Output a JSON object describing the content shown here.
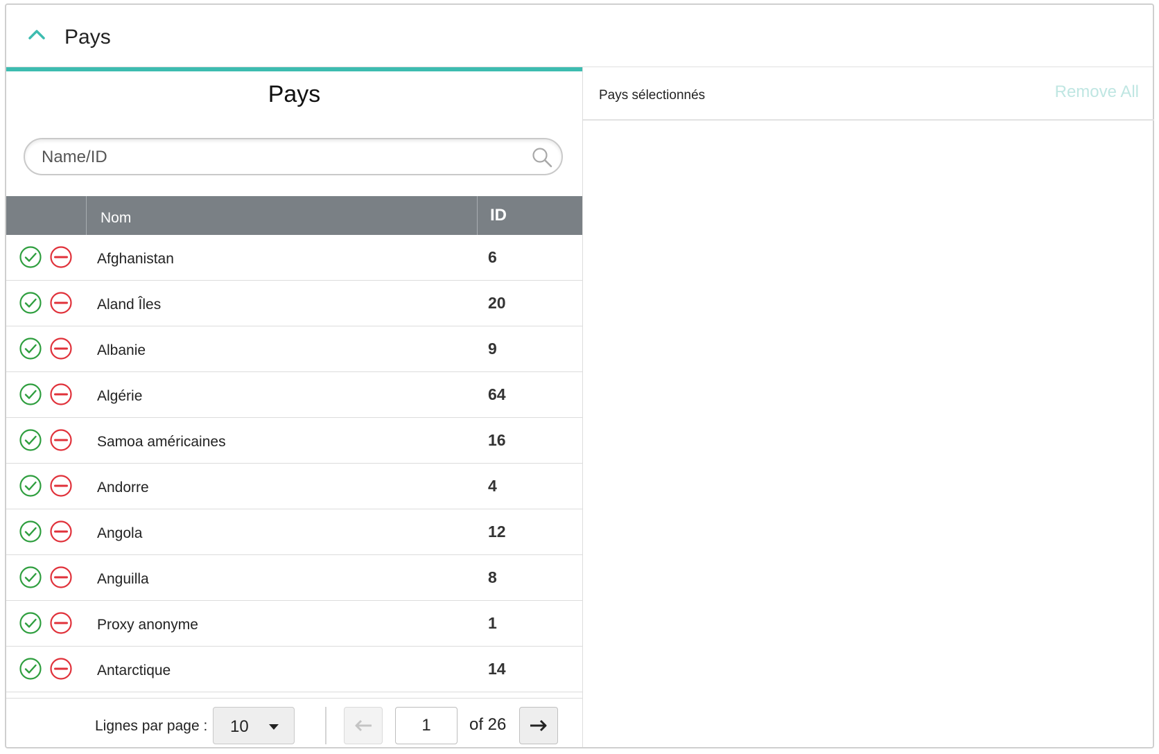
{
  "header": {
    "title": "Pays"
  },
  "left": {
    "title": "Pays",
    "search": {
      "placeholder": "Name/ID",
      "value": ""
    },
    "columns": {
      "name": "Nom",
      "id": "ID"
    },
    "rows": [
      {
        "name": "Afghanistan",
        "id": "6"
      },
      {
        "name": "Aland  Îles",
        "id": "20"
      },
      {
        "name": "Albanie",
        "id": "9"
      },
      {
        "name": "Algérie",
        "id": "64"
      },
      {
        "name": "Samoa américaines",
        "id": "16"
      },
      {
        "name": "Andorre",
        "id": "4"
      },
      {
        "name": "Angola",
        "id": "12"
      },
      {
        "name": "Anguilla",
        "id": "8"
      },
      {
        "name": "Proxy anonyme",
        "id": "1"
      },
      {
        "name": "Antarctique",
        "id": "14"
      }
    ],
    "pagination": {
      "rows_per_page_label": "Lignes par page :",
      "rows_per_page": "10",
      "page": "1",
      "of_label": "of 26"
    }
  },
  "right": {
    "title": "Pays sélectionnés",
    "remove_all": "Remove All"
  },
  "colors": {
    "accent": "#3dbcb0",
    "header_bg": "#7a8085",
    "ok": "#2e9e3e",
    "remove": "#e0313a",
    "remove_all_disabled": "#bfe6e2"
  },
  "icons": {
    "collapse": "chevron-up-icon",
    "search": "search-icon",
    "add": "check-circle-icon",
    "remove": "minus-circle-icon",
    "prev": "arrow-left-icon",
    "next": "arrow-right-icon"
  }
}
